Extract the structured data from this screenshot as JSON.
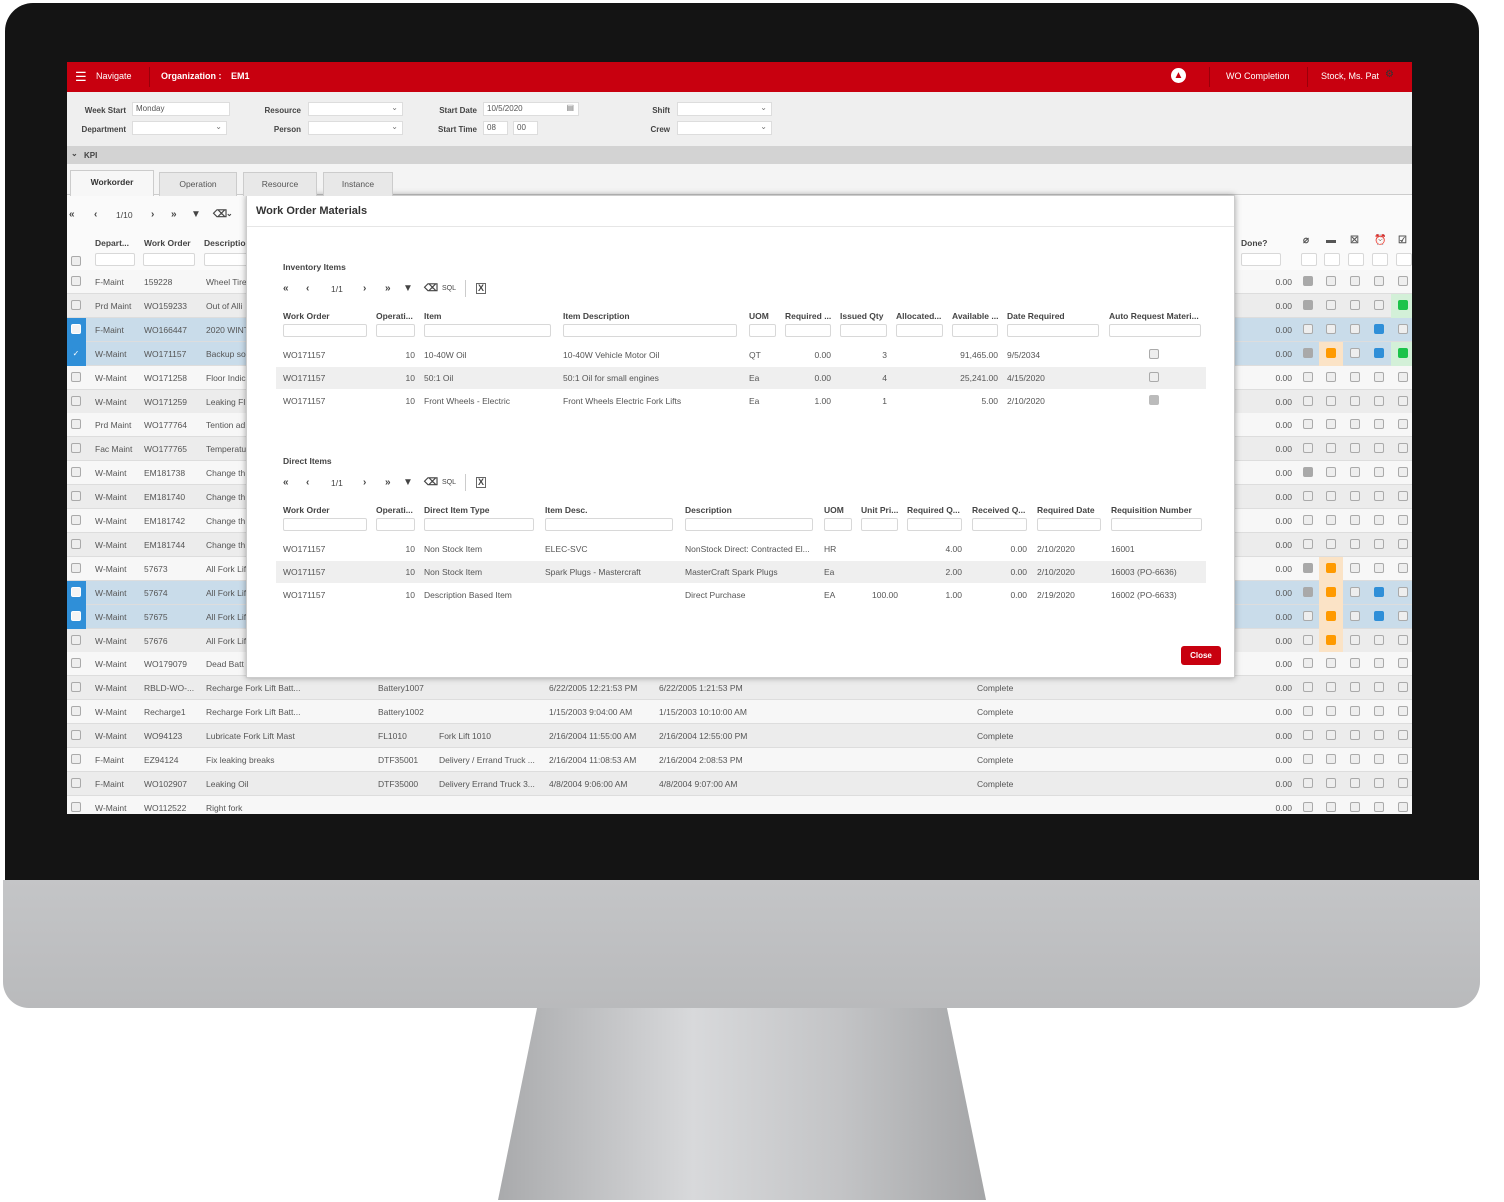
{
  "colors": {
    "brand": "#c8000f",
    "selected_row": "#c9dcea",
    "checkbox_blue": "#2f8fd8",
    "orange": "#ff9a00",
    "green": "#1cc34a",
    "gray": "#a9a9a9"
  },
  "topbar": {
    "menu_icon": "hamburger-icon",
    "navigate": "Navigate",
    "organization_label": "Organization :",
    "organization_value": "EM1",
    "logo_icon": "flame-logo-icon",
    "wo_completion": "WO Completion",
    "user": "Stock, Ms. Pat",
    "settings_icon": "gear-icon"
  },
  "filters": {
    "week_start_label": "Week Start",
    "week_start_value": "Monday",
    "department_label": "Department",
    "department_value": "",
    "resource_label": "Resource",
    "resource_value": "",
    "person_label": "Person",
    "person_value": "",
    "start_date_label": "Start Date",
    "start_date_value": "10/5/2020",
    "start_time_label": "Start Time",
    "start_time_hour": "08",
    "start_time_minute": "00",
    "shift_label": "Shift",
    "shift_value": "",
    "crew_label": "Crew",
    "crew_value": ""
  },
  "kpi": {
    "label": "KPI"
  },
  "tabs": [
    {
      "label": "Workorder",
      "active": true
    },
    {
      "label": "Operation"
    },
    {
      "label": "Resource"
    },
    {
      "label": "Instance"
    }
  ],
  "grid": {
    "page": "1/10",
    "headers": {
      "department": "Depart...",
      "work_order": "Work Order",
      "description": "Descriptio",
      "done": "Done?"
    },
    "status_icons": [
      "paperclip-icon",
      "archive-icon",
      "cancel-box-icon",
      "alarm-clock-icon",
      "checkbox-icon"
    ],
    "rows": [
      {
        "dept": "F-Maint",
        "wo": "159228",
        "desc": "Wheel Tire",
        "done": "0.00",
        "flags": "geeee"
      },
      {
        "dept": "Prd Maint",
        "wo": "WO159233",
        "desc": "Out of Alli",
        "done": "0.00",
        "flags": "geeeG"
      },
      {
        "dept": "F-Maint",
        "wo": "WO166447",
        "desc": "2020 WINT",
        "done": "0.00",
        "flags": "eeebe",
        "selected": true
      },
      {
        "dept": "W-Maint",
        "wo": "WO171157",
        "desc": "Backup so",
        "done": "0.00",
        "flags": "goebG",
        "selected": true,
        "checked": true
      },
      {
        "dept": "W-Maint",
        "wo": "WO171258",
        "desc": "Floor Indic",
        "done": "0.00",
        "flags": "eeeee"
      },
      {
        "dept": "W-Maint",
        "wo": "WO171259",
        "desc": "Leaking Fl",
        "done": "0.00",
        "flags": "eeeee"
      },
      {
        "dept": "Prd Maint",
        "wo": "WO177764",
        "desc": "Tention ad",
        "done": "0.00",
        "flags": "eeeee"
      },
      {
        "dept": "Fac Maint",
        "wo": "WO177765",
        "desc": "Temperatu",
        "done": "0.00",
        "flags": "eeeee"
      },
      {
        "dept": "W-Maint",
        "wo": "EM181738",
        "desc": "Change th",
        "done": "0.00",
        "flags": "geeee"
      },
      {
        "dept": "W-Maint",
        "wo": "EM181740",
        "desc": "Change th",
        "done": "0.00",
        "flags": "eeeee"
      },
      {
        "dept": "W-Maint",
        "wo": "EM181742",
        "desc": "Change th",
        "done": "0.00",
        "flags": "eeeee"
      },
      {
        "dept": "W-Maint",
        "wo": "EM181744",
        "desc": "Change th",
        "done": "0.00",
        "flags": "eeeee"
      },
      {
        "dept": "W-Maint",
        "wo": "57673",
        "desc": "All Fork Lif",
        "done": "0.00",
        "flags": "goeee"
      },
      {
        "dept": "W-Maint",
        "wo": "57674",
        "desc": "All Fork Lif",
        "done": "0.00",
        "flags": "goebe",
        "selected": true
      },
      {
        "dept": "W-Maint",
        "wo": "57675",
        "desc": "All Fork Lif",
        "done": "0.00",
        "flags": "eoebe",
        "selected": true
      },
      {
        "dept": "W-Maint",
        "wo": "57676",
        "desc": "All Fork Lif",
        "done": "0.00",
        "flags": "eoeee"
      },
      {
        "dept": "W-Maint",
        "wo": "WO179079",
        "desc": "Dead Batt",
        "done": "0.00",
        "flags": "eeeee"
      },
      {
        "dept": "W-Maint",
        "wo": "RBLD-WO-...",
        "desc": "Recharge Fork Lift Batt...",
        "asset": "Battery1007",
        "asset_desc": "",
        "start": "6/22/2005 12:21:53 PM",
        "end": "6/22/2005 1:21:53 PM",
        "status": "Complete",
        "done": "0.00",
        "flags": "eeeee"
      },
      {
        "dept": "W-Maint",
        "wo": "Recharge1",
        "desc": "Recharge Fork Lift Batt...",
        "asset": "Battery1002",
        "asset_desc": "",
        "start": "1/15/2003 9:04:00 AM",
        "end": "1/15/2003 10:10:00 AM",
        "status": "Complete",
        "done": "0.00",
        "flags": "eeeee"
      },
      {
        "dept": "W-Maint",
        "wo": "WO94123",
        "desc": "Lubricate Fork Lift Mast",
        "asset": "FL1010",
        "asset_desc": "Fork Lift 1010",
        "start": "2/16/2004 11:55:00 AM",
        "end": "2/16/2004 12:55:00 PM",
        "status": "Complete",
        "done": "0.00",
        "flags": "eeeee"
      },
      {
        "dept": "F-Maint",
        "wo": "EZ94124",
        "desc": "Fix leaking breaks",
        "asset": "DTF35001",
        "asset_desc": "Delivery / Errand Truck ...",
        "start": "2/16/2004 11:08:53 AM",
        "end": "2/16/2004 2:08:53 PM",
        "status": "Complete",
        "done": "0.00",
        "flags": "eeeee"
      },
      {
        "dept": "F-Maint",
        "wo": "WO102907",
        "desc": "Leaking Oil",
        "asset": "DTF35000",
        "asset_desc": "Delivery Errand Truck 3...",
        "start": "4/8/2004 9:06:00 AM",
        "end": "4/8/2004 9:07:00 AM",
        "status": "Complete",
        "done": "0.00",
        "flags": "eeeee"
      },
      {
        "dept": "W-Maint",
        "wo": "WO112522",
        "desc": "Right fork",
        "done": "0.00",
        "flags": "eeeee"
      }
    ]
  },
  "modal": {
    "title": "Work Order Materials",
    "close_label": "Close",
    "inventory": {
      "label": "Inventory Items",
      "page": "1/1",
      "sql": "SQL",
      "headers": [
        "Work Order",
        "Operati...",
        "Item",
        "Item Description",
        "UOM",
        "Required ...",
        "Issued Qty",
        "Allocated...",
        "Available ...",
        "Date Required",
        "Auto Request Materi..."
      ],
      "rows": [
        {
          "wo": "WO171157",
          "op": "10",
          "item": "10-40W Oil",
          "desc": "10-40W Vehicle Motor Oil",
          "uom": "QT",
          "required": "0.00",
          "issued": "3",
          "allocated": "",
          "available": "91,465.00",
          "date": "9/5/2034",
          "auto": false
        },
        {
          "wo": "WO171157",
          "op": "10",
          "item": "50:1 Oil",
          "desc": "50:1 Oil for small engines",
          "uom": "Ea",
          "required": "0.00",
          "issued": "4",
          "allocated": "",
          "available": "25,241.00",
          "date": "4/15/2020",
          "auto": false
        },
        {
          "wo": "WO171157",
          "op": "10",
          "item": "Front Wheels - Electric",
          "desc": "Front Wheels Electric Fork Lifts",
          "uom": "Ea",
          "required": "1.00",
          "issued": "1",
          "allocated": "",
          "available": "5.00",
          "date": "2/10/2020",
          "auto": true
        }
      ]
    },
    "direct": {
      "label": "Direct Items",
      "page": "1/1",
      "sql": "SQL",
      "headers": [
        "Work Order",
        "Operati...",
        "Direct Item Type",
        "Item Desc.",
        "Description",
        "UOM",
        "Unit Pri...",
        "Required Q...",
        "Received Q...",
        "Required Date",
        "Requisition Number"
      ],
      "rows": [
        {
          "wo": "WO171157",
          "op": "10",
          "type": "Non Stock Item",
          "item_desc": "ELEC-SVC",
          "desc": "NonStock Direct: Contracted El...",
          "uom": "HR",
          "unit_price": "",
          "required": "4.00",
          "received": "0.00",
          "date": "2/10/2020",
          "req": "16001"
        },
        {
          "wo": "WO171157",
          "op": "10",
          "type": "Non Stock Item",
          "item_desc": "Spark Plugs - Mastercraft",
          "desc": "MasterCraft Spark Plugs",
          "uom": "Ea",
          "unit_price": "",
          "required": "2.00",
          "received": "0.00",
          "date": "2/10/2020",
          "req": "16003 (PO-6636)"
        },
        {
          "wo": "WO171157",
          "op": "10",
          "type": "Description Based Item",
          "item_desc": "",
          "desc": "Direct Purchase",
          "uom": "EA",
          "unit_price": "100.00",
          "required": "1.00",
          "received": "0.00",
          "date": "2/19/2020",
          "req": "16002 (PO-6633)"
        }
      ]
    }
  }
}
